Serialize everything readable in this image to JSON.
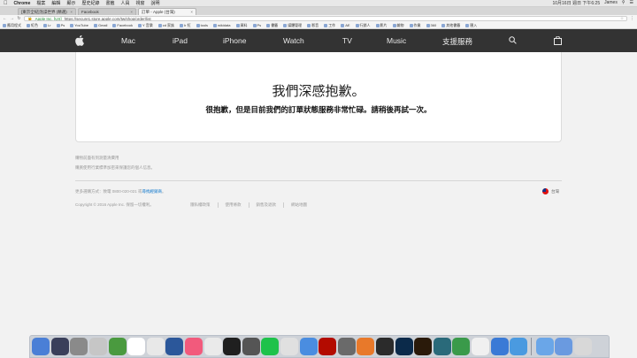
{
  "menubar": {
    "app_name": "Chrome",
    "menus": [
      "檔案",
      "編輯",
      "顯示",
      "歷史紀錄",
      "書籤",
      "人員",
      "視窗",
      "說明"
    ],
    "clock": "10月16日 週日 下午6:25",
    "user": "James"
  },
  "tabs": [
    {
      "label": "[東京全紀]泡澡世界 (精選)",
      "active": false
    },
    {
      "label": "Facebook",
      "active": false
    },
    {
      "label": "訂單 - Apple (台灣)",
      "active": true
    }
  ],
  "address": {
    "secure_label": "Apple Inc. [US]",
    "url": "https://secure1.store.apple.com/tw/shop/order/list"
  },
  "bookmarks": [
    "應用程式",
    "紅色",
    "Lr",
    "Ps",
    "YouTube",
    "Gmail",
    "Facebook",
    "Y 音樂",
    "cd 家族",
    "Ir 紅",
    "tools",
    "wikidata",
    "資料",
    "Ps",
    "書籤",
    "媒體管理",
    "影音",
    "工作",
    "AE",
    "行銷人",
    "影片",
    "雜物",
    "作業",
    "360",
    "其他書籤",
    "匯入"
  ],
  "gnav": {
    "items": [
      "Mac",
      "iPad",
      "iPhone",
      "Watch",
      "TV",
      "Music",
      "支援服務"
    ]
  },
  "error": {
    "title": "我們深感抱歉。",
    "message": "很抱歉，但是目前我們的訂單狀態服務非常忙碌。請稍後再試一次。"
  },
  "footer": {
    "line1": "購物前盡有到測量清費用",
    "line2": "購買使用行業標準加密來保護您的個人信息。",
    "shop_prefix": "更多選購方式：致電 0800-020-021 或",
    "shop_link": "尋找經銷商",
    "shop_suffix": "。",
    "region": "台灣",
    "copyright": "Copyright © 2016 Apple Inc. 保留一切權利。",
    "links": [
      "隱私權政策",
      "使用條款",
      "銷售及退款",
      "網站地圖"
    ]
  },
  "dock": {
    "colors_left": [
      "#4a7fd6",
      "#3a3f5a",
      "#8a8a8a",
      "#c6c6c6",
      "#4a9a3f",
      "#ffffff",
      "#e8e8e8",
      "#2b579a",
      "#f25a7c",
      "#eaeaea",
      "#1f1f1f",
      "#555555",
      "#1ec24a",
      "#e0e0e0",
      "#4a8de0",
      "#b30b00",
      "#6a6a6a",
      "#e8792a",
      "#2b2b2b",
      "#0b2a4a",
      "#2a1a0a",
      "#2a6a7a",
      "#3a9a4a",
      "#f0f0f0",
      "#3a7ad6",
      "#4a9ae0"
    ],
    "colors_right": [
      "#6aa6e8",
      "#6a9ae0",
      "#d8d8d8"
    ]
  }
}
